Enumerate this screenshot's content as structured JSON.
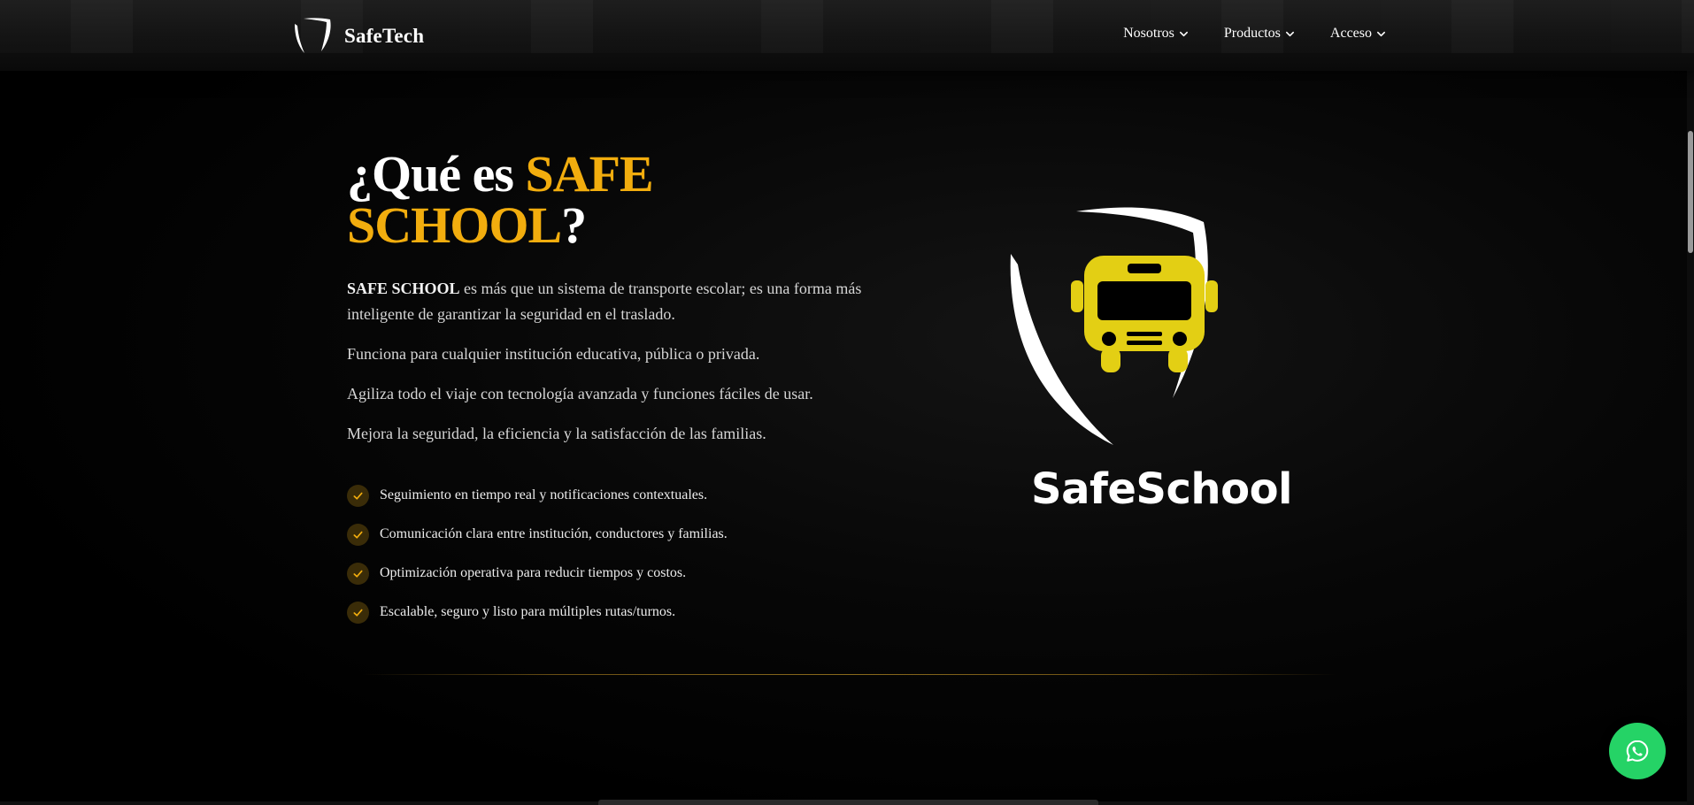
{
  "header": {
    "brand_name": "SafeTech",
    "nav": [
      {
        "label": "Nosotros"
      },
      {
        "label": "Productos"
      },
      {
        "label": "Acceso"
      }
    ]
  },
  "hero": {
    "title_prefix": "¿Qué es ",
    "title_highlight": "SAFE SCHOOL",
    "title_suffix": "?",
    "intro_strong": "SAFE SCHOOL",
    "intro_rest": " es más que un sistema de transporte escolar; es una forma más inteligente de garantizar la seguridad en el traslado.",
    "paragraphs": [
      "Funciona para cualquier institución educativa, pública o privada.",
      "Agiliza todo el viaje con tecnología avanzada y funciones fáciles de usar.",
      "Mejora la seguridad, la eficiencia y la satisfacción de las familias."
    ],
    "features": [
      "Seguimiento en tiempo real y notificaciones contextuales.",
      "Comunicación clara entre institución, conductores y familias.",
      "Optimización operativa para reducir tiempos y costos.",
      "Escalable, seguro y listo para múltiples rutas/turnos."
    ],
    "product_logo_text": "SafeSchool"
  },
  "colors": {
    "accent": "#f2ad0e",
    "bus_yellow": "#e3cf14",
    "whatsapp_green": "#25d366",
    "background": "#000000"
  },
  "icons": {
    "brand": "shield-logo-icon",
    "nav_dropdown": "chevron-down-icon",
    "feature": "check-icon",
    "product": "school-bus-icon",
    "floating": "whatsapp-icon"
  }
}
